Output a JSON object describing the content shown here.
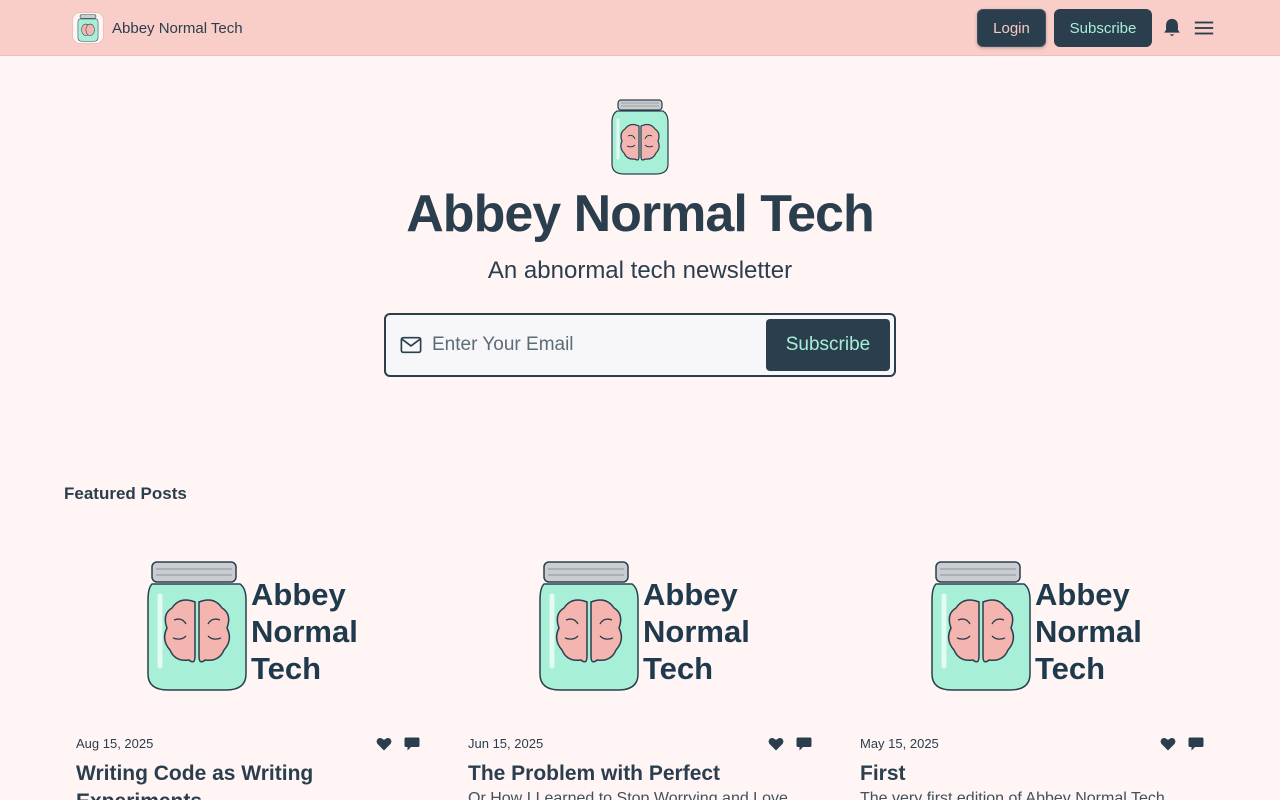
{
  "header": {
    "brand_name": "Abbey Normal Tech",
    "login_label": "Login",
    "subscribe_label": "Subscribe"
  },
  "hero": {
    "title": "Abbey Normal Tech",
    "subtitle": "An abnormal tech newsletter",
    "email_placeholder": "Enter Your Email",
    "subscribe_label": "Subscribe"
  },
  "featured": {
    "heading": "Featured Posts",
    "posts": [
      {
        "date": "Aug 15, 2025",
        "title": "Writing Code as Writing Experiments",
        "excerpt": "",
        "image_text": [
          "Abbey",
          "Normal",
          "Tech"
        ]
      },
      {
        "date": "Jun 15, 2025",
        "title": "The Problem with Perfect",
        "excerpt": "Or How I Learned to Stop Worrying and Love",
        "image_text": [
          "Abbey",
          "Normal",
          "Tech"
        ]
      },
      {
        "date": "May 15, 2025",
        "title": "First",
        "excerpt": "The very first edition of Abbey Normal Tech",
        "image_text": [
          "Abbey",
          "Normal",
          "Tech"
        ]
      }
    ]
  },
  "colors": {
    "header_bg": "#f9cdc8",
    "page_bg": "#fff5f4",
    "primary": "#2b3e4d",
    "accent_mint": "#a6efd6",
    "jar_fill": "#a8efd8",
    "brain_pink": "#f4b5b1"
  },
  "icons": [
    "brand-logo",
    "bell-icon",
    "menu-icon",
    "mail-icon",
    "heart-icon",
    "comment-icon"
  ]
}
